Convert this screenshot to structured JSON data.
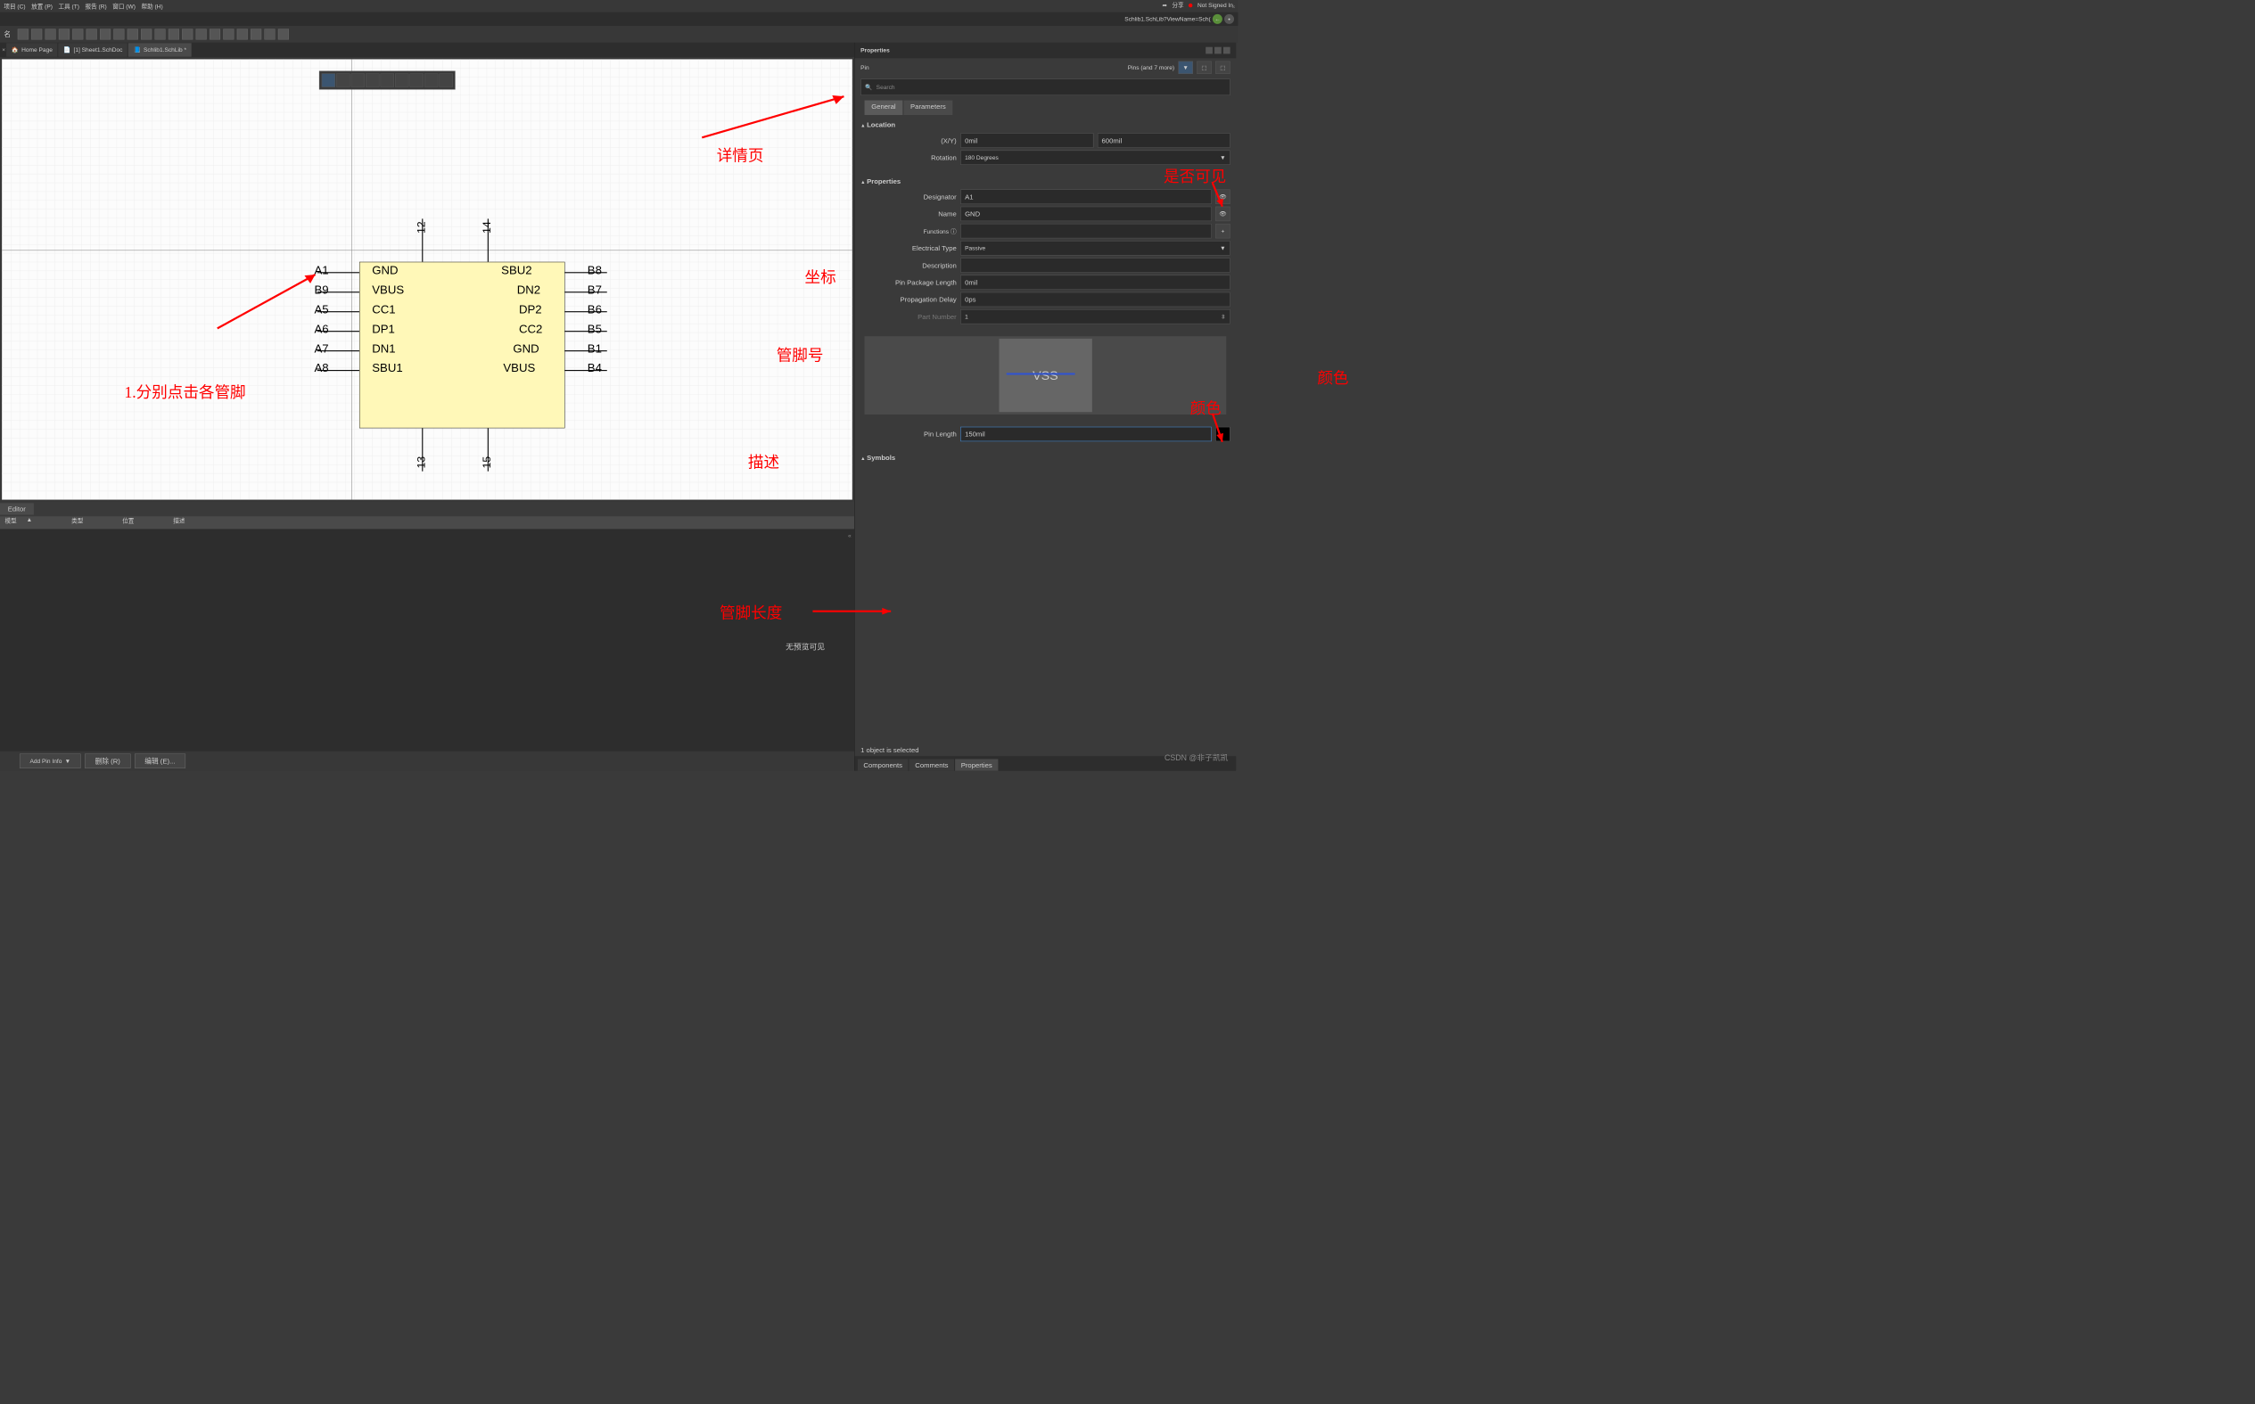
{
  "menu": {
    "items": [
      "项目 (C)",
      "放置 (P)",
      "工具 (T)",
      "报告 (R)",
      "窗口 (W)",
      "帮助 (H)"
    ]
  },
  "topright": {
    "share": "分享",
    "signed": "Not Signed In"
  },
  "breadcrumb": {
    "path": "Schlib1.SchLib?ViewName=Sch("
  },
  "tabs": {
    "close": "×",
    "t0": {
      "icon": "home",
      "label": "Home Page"
    },
    "t1": {
      "icon": "doc",
      "label": "[1] Sheet1.SchDoc"
    },
    "t2": {
      "icon": "lib",
      "label": "Schlib1.SchLib *"
    }
  },
  "editor": {
    "label": "Editor"
  },
  "model": {
    "h0": "模型",
    "h1": "类型",
    "h2": "位置",
    "h3": "描述",
    "nopreview": "无预览可见",
    "add": "Add Pin Info",
    "drop": "▼",
    "del": "删除 (R)",
    "edit": "编辑 (E)..."
  },
  "ann": {
    "a1": "1.分别点击各管脚",
    "a2": "详情页",
    "a3": "坐标",
    "a4": "管脚号",
    "a5": "是否可见",
    "a6": "描述",
    "a7": "管脚长度",
    "a8": "颜色"
  },
  "chip": {
    "left": [
      {
        "d": "A1",
        "n": "GND"
      },
      {
        "d": "B9",
        "n": "VBUS"
      },
      {
        "d": "A5",
        "n": "CC1"
      },
      {
        "d": "A6",
        "n": "DP1"
      },
      {
        "d": "A7",
        "n": "DN1"
      },
      {
        "d": "A8",
        "n": "SBU1"
      }
    ],
    "right": [
      {
        "d": "B8",
        "n": "SBU2"
      },
      {
        "d": "B7",
        "n": "DN2"
      },
      {
        "d": "B6",
        "n": "DP2"
      },
      {
        "d": "B5",
        "n": "CC2"
      },
      {
        "d": "B1",
        "n": "GND"
      },
      {
        "d": "B4",
        "n": "VBUS"
      }
    ],
    "top": [
      "12",
      "14"
    ],
    "bottom": [
      "13",
      "15"
    ]
  },
  "props": {
    "title": "Properties",
    "object": "Pin",
    "filter": "Pins (and 7 more)",
    "search": "Search",
    "tabs": {
      "gen": "General",
      "par": "Parameters"
    },
    "loc": {
      "title": "Location",
      "xy": "(X/Y)",
      "x": "0mil",
      "y": "600mil",
      "rot": "Rotation",
      "rotv": "180 Degrees"
    },
    "prop": {
      "title": "Properties",
      "des": "Designator",
      "desv": "A1",
      "name": "Name",
      "namev": "GND",
      "func": "Functions",
      "et": "Electrical Type",
      "etv": "Passive",
      "desc": "Description",
      "descv": "",
      "ppl": "Pin Package Length",
      "pplv": "0mil",
      "pd": "Propagation Delay",
      "pdv": "0ps",
      "pn": "Part Number",
      "pnv": "1"
    },
    "preview": {
      "vss": "VSS"
    },
    "pl": {
      "label": "Pin Length",
      "val": "150mil"
    },
    "sym": {
      "title": "Symbols"
    },
    "status": "1 object is selected",
    "btabs": {
      "comp": "Components",
      "comm": "Comments",
      "prop": "Properties"
    }
  },
  "watermark": "CSDN @非子凯凯"
}
